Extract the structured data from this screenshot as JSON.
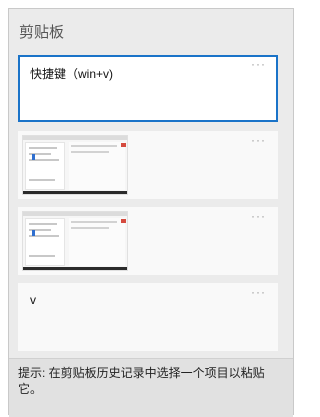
{
  "panel": {
    "title": "剪贴板",
    "items": [
      {
        "type": "text",
        "text": "快捷键（win+v)",
        "selected": true
      },
      {
        "type": "image",
        "icon": "screenshot-thumbnail"
      },
      {
        "type": "image",
        "icon": "screenshot-thumbnail"
      },
      {
        "type": "text",
        "text": "v",
        "selected": false
      }
    ],
    "more_label": "···",
    "hint": "提示: 在剪贴板历史记录中选择一个项目以粘贴它。"
  },
  "colors": {
    "accent": "#1a73c8",
    "panel_bg": "#ebebeb",
    "card_bg": "#f9f9f9",
    "hint_bg": "#e1e1e1"
  }
}
